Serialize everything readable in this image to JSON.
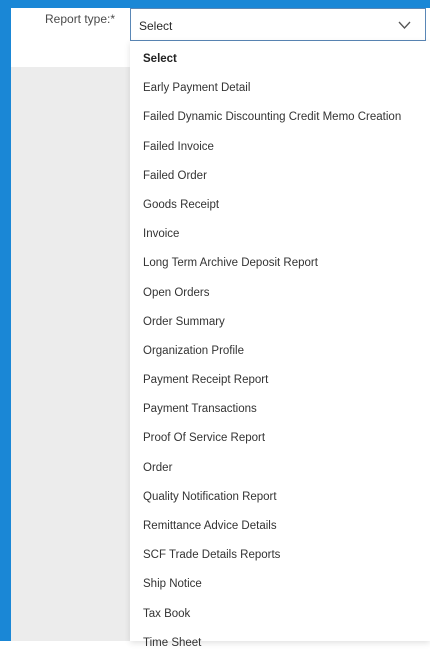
{
  "form": {
    "label": "Report type:*",
    "selected_value": "Select"
  },
  "dropdown": {
    "options": [
      "Select",
      "Early Payment Detail",
      "Failed Dynamic Discounting Credit Memo Creation",
      "Failed Invoice",
      "Failed Order",
      "Goods Receipt",
      "Invoice",
      "Long Term Archive Deposit Report",
      "Open Orders",
      "Order Summary",
      "Organization Profile",
      "Payment Receipt Report",
      "Payment Transactions",
      "Proof Of Service Report",
      "Order",
      "Quality Notification Report",
      "Remittance Advice Details",
      "SCF Trade Details Reports",
      "Ship Notice",
      "Tax Book",
      "Time Sheet"
    ]
  },
  "colors": {
    "frame": "#1a87d6",
    "background": "#ececec",
    "select_border": "#5a87b6"
  },
  "icons": {
    "select_arrow": "chevron-down-icon"
  }
}
